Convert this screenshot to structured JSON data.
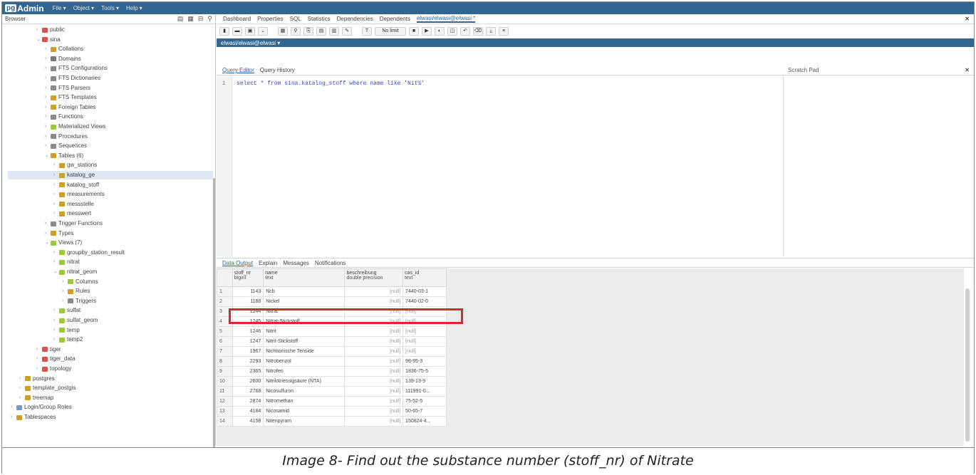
{
  "app": {
    "logo_pg": "pg",
    "logo_admin": "Admin"
  },
  "menu": [
    "File ▾",
    "Object ▾",
    "Tools ▾",
    "Help ▾"
  ],
  "browser": {
    "title": "Browser"
  },
  "tree": [
    {
      "label": "public",
      "indent": 4,
      "twisty": "›",
      "color": "#d9534f"
    },
    {
      "label": "sina",
      "indent": 4,
      "twisty": "⌄",
      "color": "#d9534f"
    },
    {
      "label": "Collations",
      "indent": 5,
      "twisty": "›",
      "color": "#c9a227"
    },
    {
      "label": "Domains",
      "indent": 5,
      "twisty": "›",
      "color": "#7a7a7a"
    },
    {
      "label": "FTS Configurations",
      "indent": 5,
      "twisty": "›",
      "color": "#8a8a8a"
    },
    {
      "label": "FTS Dictionaries",
      "indent": 5,
      "twisty": "›",
      "color": "#8a8a8a"
    },
    {
      "label": "FTS Parsers",
      "indent": 5,
      "twisty": "›",
      "color": "#8a8a8a"
    },
    {
      "label": "FTS Templates",
      "indent": 5,
      "twisty": "›",
      "color": "#c9a227"
    },
    {
      "label": "Foreign Tables",
      "indent": 5,
      "twisty": "›",
      "color": "#c9a227"
    },
    {
      "label": "Functions",
      "indent": 5,
      "twisty": "›",
      "color": "#8a8a8a"
    },
    {
      "label": "Materialized Views",
      "indent": 5,
      "twisty": "›",
      "color": "#9bc93b"
    },
    {
      "label": "Procedures",
      "indent": 5,
      "twisty": "›",
      "color": "#8a8a8a"
    },
    {
      "label": "Sequences",
      "indent": 5,
      "twisty": "›",
      "color": "#8a8a8a"
    },
    {
      "label": "Tables (6)",
      "indent": 5,
      "twisty": "⌄",
      "color": "#c9a227"
    },
    {
      "label": "gw_stations",
      "indent": 6,
      "twisty": "›",
      "color": "#c9a227"
    },
    {
      "label": "katalog_ge",
      "indent": 6,
      "twisty": "›",
      "color": "#c9a227",
      "selected": true
    },
    {
      "label": "katalog_stoff",
      "indent": 6,
      "twisty": "›",
      "color": "#c9a227"
    },
    {
      "label": "measurements",
      "indent": 6,
      "twisty": "›",
      "color": "#c9a227"
    },
    {
      "label": "messstelle",
      "indent": 6,
      "twisty": "›",
      "color": "#c9a227"
    },
    {
      "label": "messwert",
      "indent": 6,
      "twisty": "›",
      "color": "#c9a227"
    },
    {
      "label": "Trigger Functions",
      "indent": 5,
      "twisty": "›",
      "color": "#8a8a8a"
    },
    {
      "label": "Types",
      "indent": 5,
      "twisty": "›",
      "color": "#c9a227"
    },
    {
      "label": "Views (7)",
      "indent": 5,
      "twisty": "⌄",
      "color": "#9bc93b"
    },
    {
      "label": "groupby_station_result",
      "indent": 6,
      "twisty": "›",
      "color": "#9bc93b"
    },
    {
      "label": "nitrat",
      "indent": 6,
      "twisty": "›",
      "color": "#9bc93b"
    },
    {
      "label": "nitrat_geom",
      "indent": 6,
      "twisty": "⌄",
      "color": "#9bc93b"
    },
    {
      "label": "Columns",
      "indent": 7,
      "twisty": "›",
      "color": "#9bc93b"
    },
    {
      "label": "Rules",
      "indent": 7,
      "twisty": "›",
      "color": "#c9a227"
    },
    {
      "label": "Triggers",
      "indent": 7,
      "twisty": "›",
      "color": "#8a8a8a"
    },
    {
      "label": "sulfat",
      "indent": 6,
      "twisty": "›",
      "color": "#9bc93b"
    },
    {
      "label": "sulfat_geom",
      "indent": 6,
      "twisty": "›",
      "color": "#9bc93b"
    },
    {
      "label": "temp",
      "indent": 6,
      "twisty": "›",
      "color": "#9bc93b"
    },
    {
      "label": "temp2",
      "indent": 6,
      "twisty": "›",
      "color": "#9bc93b"
    },
    {
      "label": "tiger",
      "indent": 4,
      "twisty": "›",
      "color": "#d9534f"
    },
    {
      "label": "tiger_data",
      "indent": 4,
      "twisty": "›",
      "color": "#d9534f"
    },
    {
      "label": "topology",
      "indent": 4,
      "twisty": "›",
      "color": "#d9534f"
    },
    {
      "label": "postgres",
      "indent": 2,
      "twisty": "›",
      "color": "#c9a227"
    },
    {
      "label": "template_postgis",
      "indent": 2,
      "twisty": "›",
      "color": "#c9a227"
    },
    {
      "label": "treemap",
      "indent": 2,
      "twisty": "›",
      "color": "#c9a227"
    },
    {
      "label": "Login/Group Roles",
      "indent": 1,
      "twisty": "›",
      "color": "#7a9ac9"
    },
    {
      "label": "Tablespaces",
      "indent": 1,
      "twisty": "›",
      "color": "#c9a227"
    }
  ],
  "tabs": [
    "Dashboard",
    "Properties",
    "SQL",
    "Statistics",
    "Dependencies",
    "Dependents"
  ],
  "query_tab": "elwasi/elwasi@elwasi *",
  "connection": "elwasi/elwasi@elwasi ▾",
  "limit": "No limit",
  "editor_tabs": {
    "query_editor": "Query Editor",
    "query_history": "Query History"
  },
  "scratch_pad": "Scratch Pad",
  "sql": {
    "line": "1",
    "text": "select * from sina.katalog_stoff where name like 'Nit%'"
  },
  "output_tabs": [
    "Data Output",
    "Explain",
    "Messages",
    "Notifications"
  ],
  "columns": [
    {
      "name": "stoff_nr",
      "type": "bigint"
    },
    {
      "name": "name",
      "type": "text"
    },
    {
      "name": "beschreibung",
      "type": "double precision"
    },
    {
      "name": "cas_id",
      "type": "text"
    }
  ],
  "rows": [
    [
      "1",
      "1143",
      "Ncb",
      "[null]",
      "7440-03-1"
    ],
    [
      "2",
      "1188",
      "Nickel",
      "[null]",
      "7440-02-0"
    ],
    [
      "3",
      "1244",
      "Nitrat",
      "[null]",
      "[null]"
    ],
    [
      "4",
      "1245",
      "Nitrat-Stickstoff",
      "[null]",
      "[null]"
    ],
    [
      "5",
      "1246",
      "Nitrit",
      "[null]",
      "[null]"
    ],
    [
      "6",
      "1247",
      "Nitrit-Stickstoff",
      "[null]",
      "[null]"
    ],
    [
      "7",
      "1967",
      "Nichtionische Tenside",
      "[null]",
      "[null]"
    ],
    [
      "8",
      "2293",
      "Nitrobenzol",
      "[null]",
      "98-95-3"
    ],
    [
      "9",
      "2365",
      "Nitrofen",
      "[null]",
      "1836-75-5"
    ],
    [
      "10",
      "2600",
      "Nitrilotriessigsäure (NTA)",
      "[null]",
      "139-13-9"
    ],
    [
      "11",
      "2768",
      "Nicosulfuron",
      "[null]",
      "111991-0..."
    ],
    [
      "12",
      "2874",
      "Nitromethan",
      "[null]",
      "75-52-5"
    ],
    [
      "13",
      "4184",
      "Nicosamid",
      "[null]",
      "50-65-7"
    ],
    [
      "14",
      "4158",
      "Nitenpyram",
      "[null]",
      "150824-4..."
    ]
  ],
  "caption": "Image 8- Find out the substance number (stoff_nr) of Nitrate"
}
